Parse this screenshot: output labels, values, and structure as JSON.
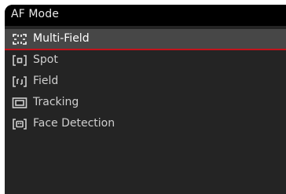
{
  "header": {
    "title": "AF Mode"
  },
  "menu": {
    "selected_index": 0,
    "accent_color": "#c3121b",
    "items": [
      {
        "label": "Multi-Field",
        "icon": "multi-field-icon"
      },
      {
        "label": "Spot",
        "icon": "spot-icon"
      },
      {
        "label": "Field",
        "icon": "field-icon"
      },
      {
        "label": "Tracking",
        "icon": "tracking-icon"
      },
      {
        "label": "Face Detection",
        "icon": "face-detection-icon"
      }
    ]
  }
}
